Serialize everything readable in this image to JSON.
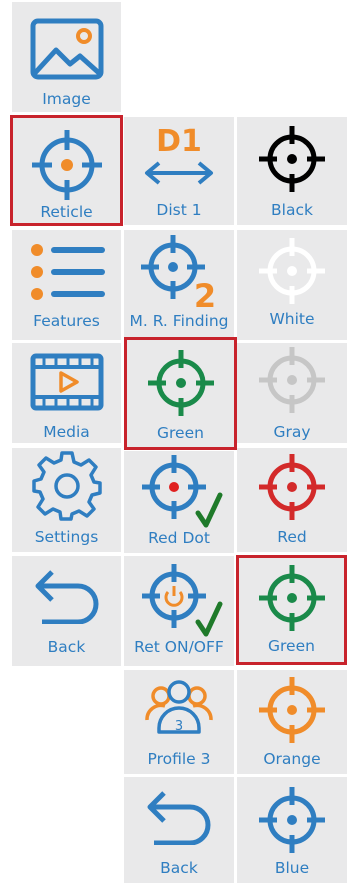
{
  "colors": {
    "tile_bg": "#e9e9ea",
    "selection_border": "#c8232c",
    "accent_blue": "#2f7ec1",
    "accent_orange": "#f08c2a",
    "check_green": "#1f7a2a"
  },
  "menu": {
    "col1": [
      {
        "label": "Image",
        "icon": "image-icon"
      },
      {
        "label": "Reticle",
        "icon": "reticle-icon",
        "selected": true
      },
      {
        "label": "Features",
        "icon": "list-icon"
      },
      {
        "label": "Media",
        "icon": "film-play-icon"
      },
      {
        "label": "Settings",
        "icon": "gear-icon"
      },
      {
        "label": "Back",
        "icon": "back-arrow-icon"
      }
    ],
    "col2": [
      {
        "label": "Dist 1",
        "icon": "distance-icon",
        "badge": "D1"
      },
      {
        "label": "M. R. Finding",
        "icon": "reticle-2-icon",
        "badge": "2"
      },
      {
        "label": "Green",
        "icon": "reticle-green-icon",
        "selected": true
      },
      {
        "label": "Red Dot",
        "icon": "reticle-red-dot-icon",
        "checked": true
      },
      {
        "label": "Ret ON/OFF",
        "icon": "reticle-power-icon",
        "checked": true
      },
      {
        "label": "Profile 3",
        "icon": "profile-icon",
        "badge": "3"
      },
      {
        "label": "Back",
        "icon": "back-arrow-icon"
      }
    ],
    "col3": [
      {
        "label": "Black",
        "icon": "reticle-black-icon",
        "color": "#000000"
      },
      {
        "label": "White",
        "icon": "reticle-white-icon",
        "color": "#ffffff"
      },
      {
        "label": "Gray",
        "icon": "reticle-gray-icon",
        "color": "#c6c6c6"
      },
      {
        "label": "Red",
        "icon": "reticle-red-icon",
        "color": "#d32a2a"
      },
      {
        "label": "Green",
        "icon": "reticle-green-icon",
        "color": "#1a8a4a",
        "selected": true
      },
      {
        "label": "Orange",
        "icon": "reticle-orange-icon",
        "color": "#f08c2a"
      },
      {
        "label": "Blue",
        "icon": "reticle-blue-icon",
        "color": "#2f7ec1"
      }
    ]
  }
}
